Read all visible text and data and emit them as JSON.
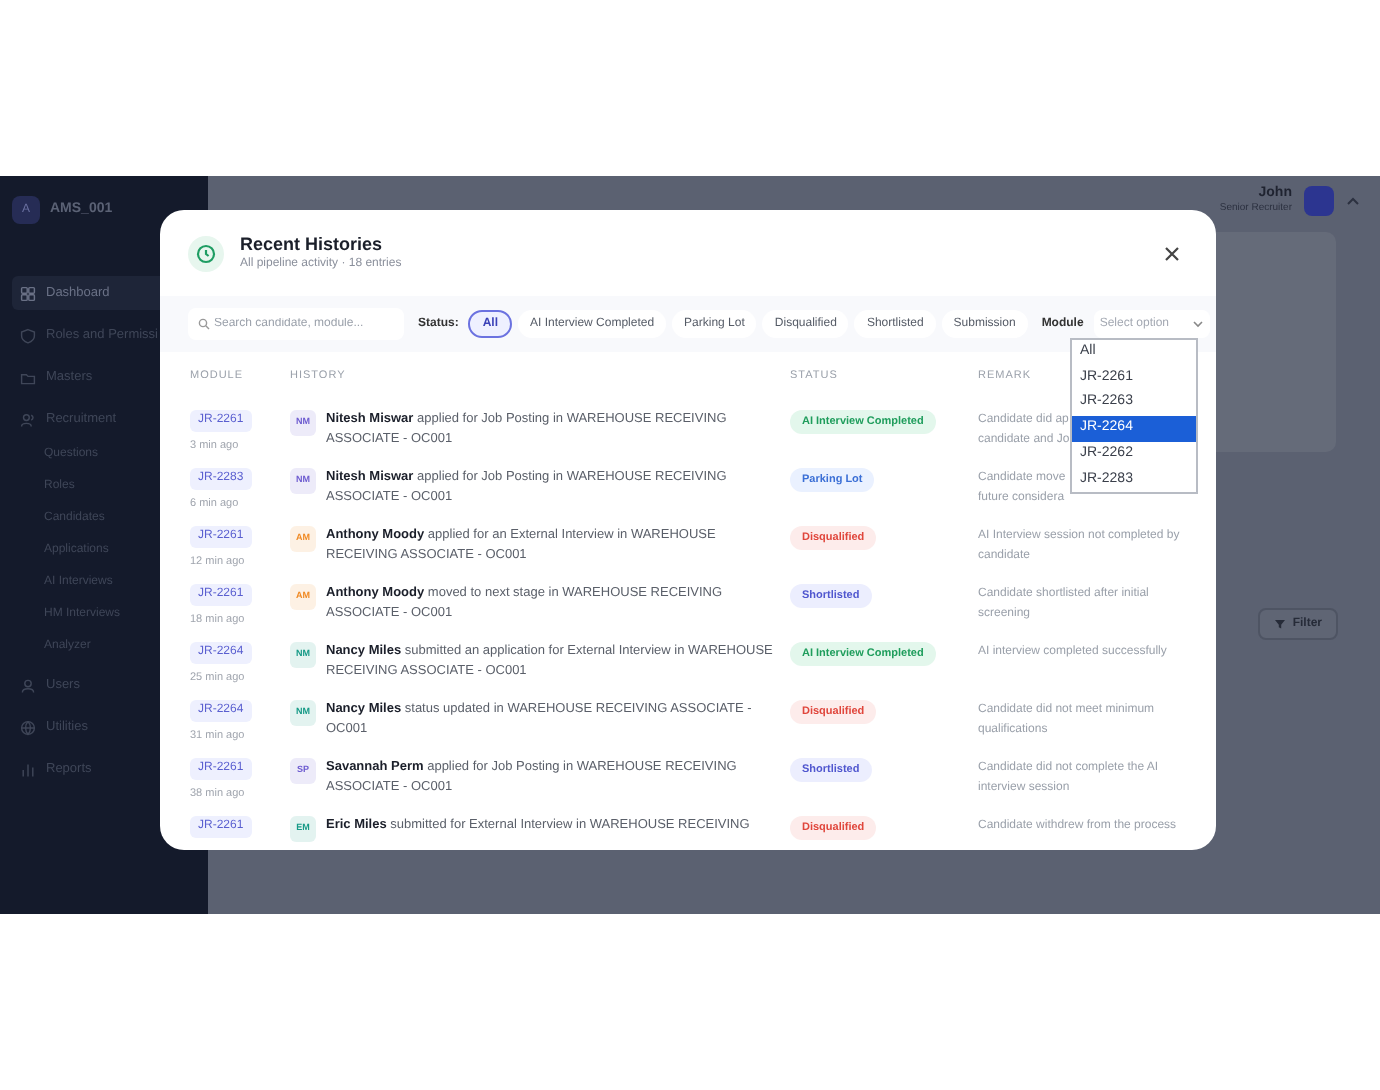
{
  "sidebar": {
    "brand": "AMS_001",
    "avatar": "A",
    "items": [
      {
        "label": "Dashboard",
        "selected": true,
        "kind": "top"
      },
      {
        "label": "Roles and Permissi",
        "selected": false,
        "kind": "top"
      },
      {
        "label": "Masters",
        "selected": false,
        "kind": "top"
      },
      {
        "label": "Recruitment",
        "selected": false,
        "kind": "top"
      },
      {
        "label": "Questions",
        "selected": false,
        "kind": "sub"
      },
      {
        "label": "Roles",
        "selected": false,
        "kind": "sub"
      },
      {
        "label": "Candidates",
        "selected": false,
        "kind": "sub"
      },
      {
        "label": "Applications",
        "selected": false,
        "kind": "sub"
      },
      {
        "label": "AI Interviews",
        "selected": false,
        "kind": "sub"
      },
      {
        "label": "HM Interviews",
        "selected": false,
        "kind": "sub"
      },
      {
        "label": "Analyzer",
        "selected": false,
        "kind": "sub"
      },
      {
        "label": "Users",
        "selected": false,
        "kind": "top"
      },
      {
        "label": "Utilities",
        "selected": false,
        "kind": "top"
      },
      {
        "label": "Reports",
        "selected": false,
        "kind": "top"
      }
    ]
  },
  "header": {
    "user_name": "John",
    "user_role": "Senior Recruiter"
  },
  "filter_button": "Filter",
  "modal": {
    "title": "Recent Histories",
    "subtitle": "All pipeline activity · 18 entries",
    "search": {
      "placeholder": "Search candidate, module..."
    },
    "status_label": "Status:",
    "status_chips": [
      {
        "label": "All",
        "selected": true
      },
      {
        "label": "AI Interview Completed",
        "selected": false
      },
      {
        "label": "Parking Lot",
        "selected": false
      },
      {
        "label": "Disqualified",
        "selected": false
      },
      {
        "label": "Shortlisted",
        "selected": false
      },
      {
        "label": "Submission",
        "selected": false
      }
    ],
    "module_label": "Module",
    "module_select": {
      "placeholder": "Select option",
      "expanded": true,
      "options": [
        {
          "label": "All",
          "selected": false
        },
        {
          "label": "JR-2261",
          "selected": false
        },
        {
          "label": "JR-2263",
          "selected": false
        },
        {
          "label": "JR-2264",
          "selected": true
        },
        {
          "label": "JR-2262",
          "selected": false
        },
        {
          "label": "JR-2283",
          "selected": false
        }
      ]
    },
    "columns": [
      "MODULE",
      "HISTORY",
      "STATUS",
      "REMARK"
    ],
    "rows": [
      {
        "module": "JR-2261",
        "time": "3 min ago",
        "initials": "NM",
        "color": "#6d5bd0",
        "history": "**Nitesh Miswar** applied for Job Posting in WAREHOUSE RECEIVING ASSOCIATE - OC001",
        "status": "AI Interview Completed",
        "kind": "completed",
        "remark_lines": [
          "Candidate did ap",
          "candidate and Jo"
        ]
      },
      {
        "module": "JR-2283",
        "time": "6 min ago",
        "initials": "NM",
        "color": "#6d5bd0",
        "history": "**Nitesh Miswar** applied for Job Posting in WAREHOUSE RECEIVING ASSOCIATE - OC001",
        "status": "Parking Lot",
        "kind": "parking",
        "remark_lines": [
          "Candidate move",
          "future considera"
        ]
      },
      {
        "module": "JR-2261",
        "time": "12 min ago",
        "initials": "AM",
        "color": "#f08a24",
        "history": "**Anthony Moody** applied for an External Interview in WAREHOUSE RECEIVING ASSOCIATE - OC001",
        "status": "Disqualified",
        "kind": "disqualified",
        "remark_lines": [
          "AI Interview session not completed by",
          "candidate"
        ]
      },
      {
        "module": "JR-2261",
        "time": "18 min ago",
        "initials": "AM",
        "color": "#f08a24",
        "history": "**Anthony Moody** moved to next stage in WAREHOUSE RECEIVING ASSOCIATE - OC001",
        "status": "Shortlisted",
        "kind": "shortlisted",
        "remark_lines": [
          "Candidate shortlisted after initial",
          "screening"
        ]
      },
      {
        "module": "JR-2264",
        "time": "25 min ago",
        "initials": "NM",
        "color": "#159a86",
        "history": "**Nancy Miles** submitted an application for External Interview in WAREHOUSE RECEIVING ASSOCIATE - OC001",
        "status": "AI Interview Completed",
        "kind": "completed",
        "remark_lines": [
          "AI interview completed successfully"
        ]
      },
      {
        "module": "JR-2264",
        "time": "31 min ago",
        "initials": "NM",
        "color": "#159a86",
        "history": "**Nancy Miles** status updated in WAREHOUSE RECEIVING ASSOCIATE - OC001",
        "status": "Disqualified",
        "kind": "disqualified",
        "remark_lines": [
          "Candidate did not meet minimum",
          "qualifications"
        ]
      },
      {
        "module": "JR-2261",
        "time": "38 min ago",
        "initials": "SP",
        "color": "#6d5bd0",
        "history": "**Savannah Perm** applied for Job Posting in WAREHOUSE RECEIVING ASSOCIATE - OC001",
        "status": "Shortlisted",
        "kind": "shortlisted",
        "remark_lines": [
          "Candidate did not complete the AI",
          "interview session"
        ]
      },
      {
        "module": "JR-2261",
        "initials": "EM",
        "color": "#159a86",
        "history": "**Eric Miles** submitted for External Interview in WAREHOUSE RECEIVING",
        "status": "Disqualified",
        "kind": "disqualified",
        "remark_lines": [
          "Candidate withdrew from the process"
        ]
      }
    ]
  }
}
